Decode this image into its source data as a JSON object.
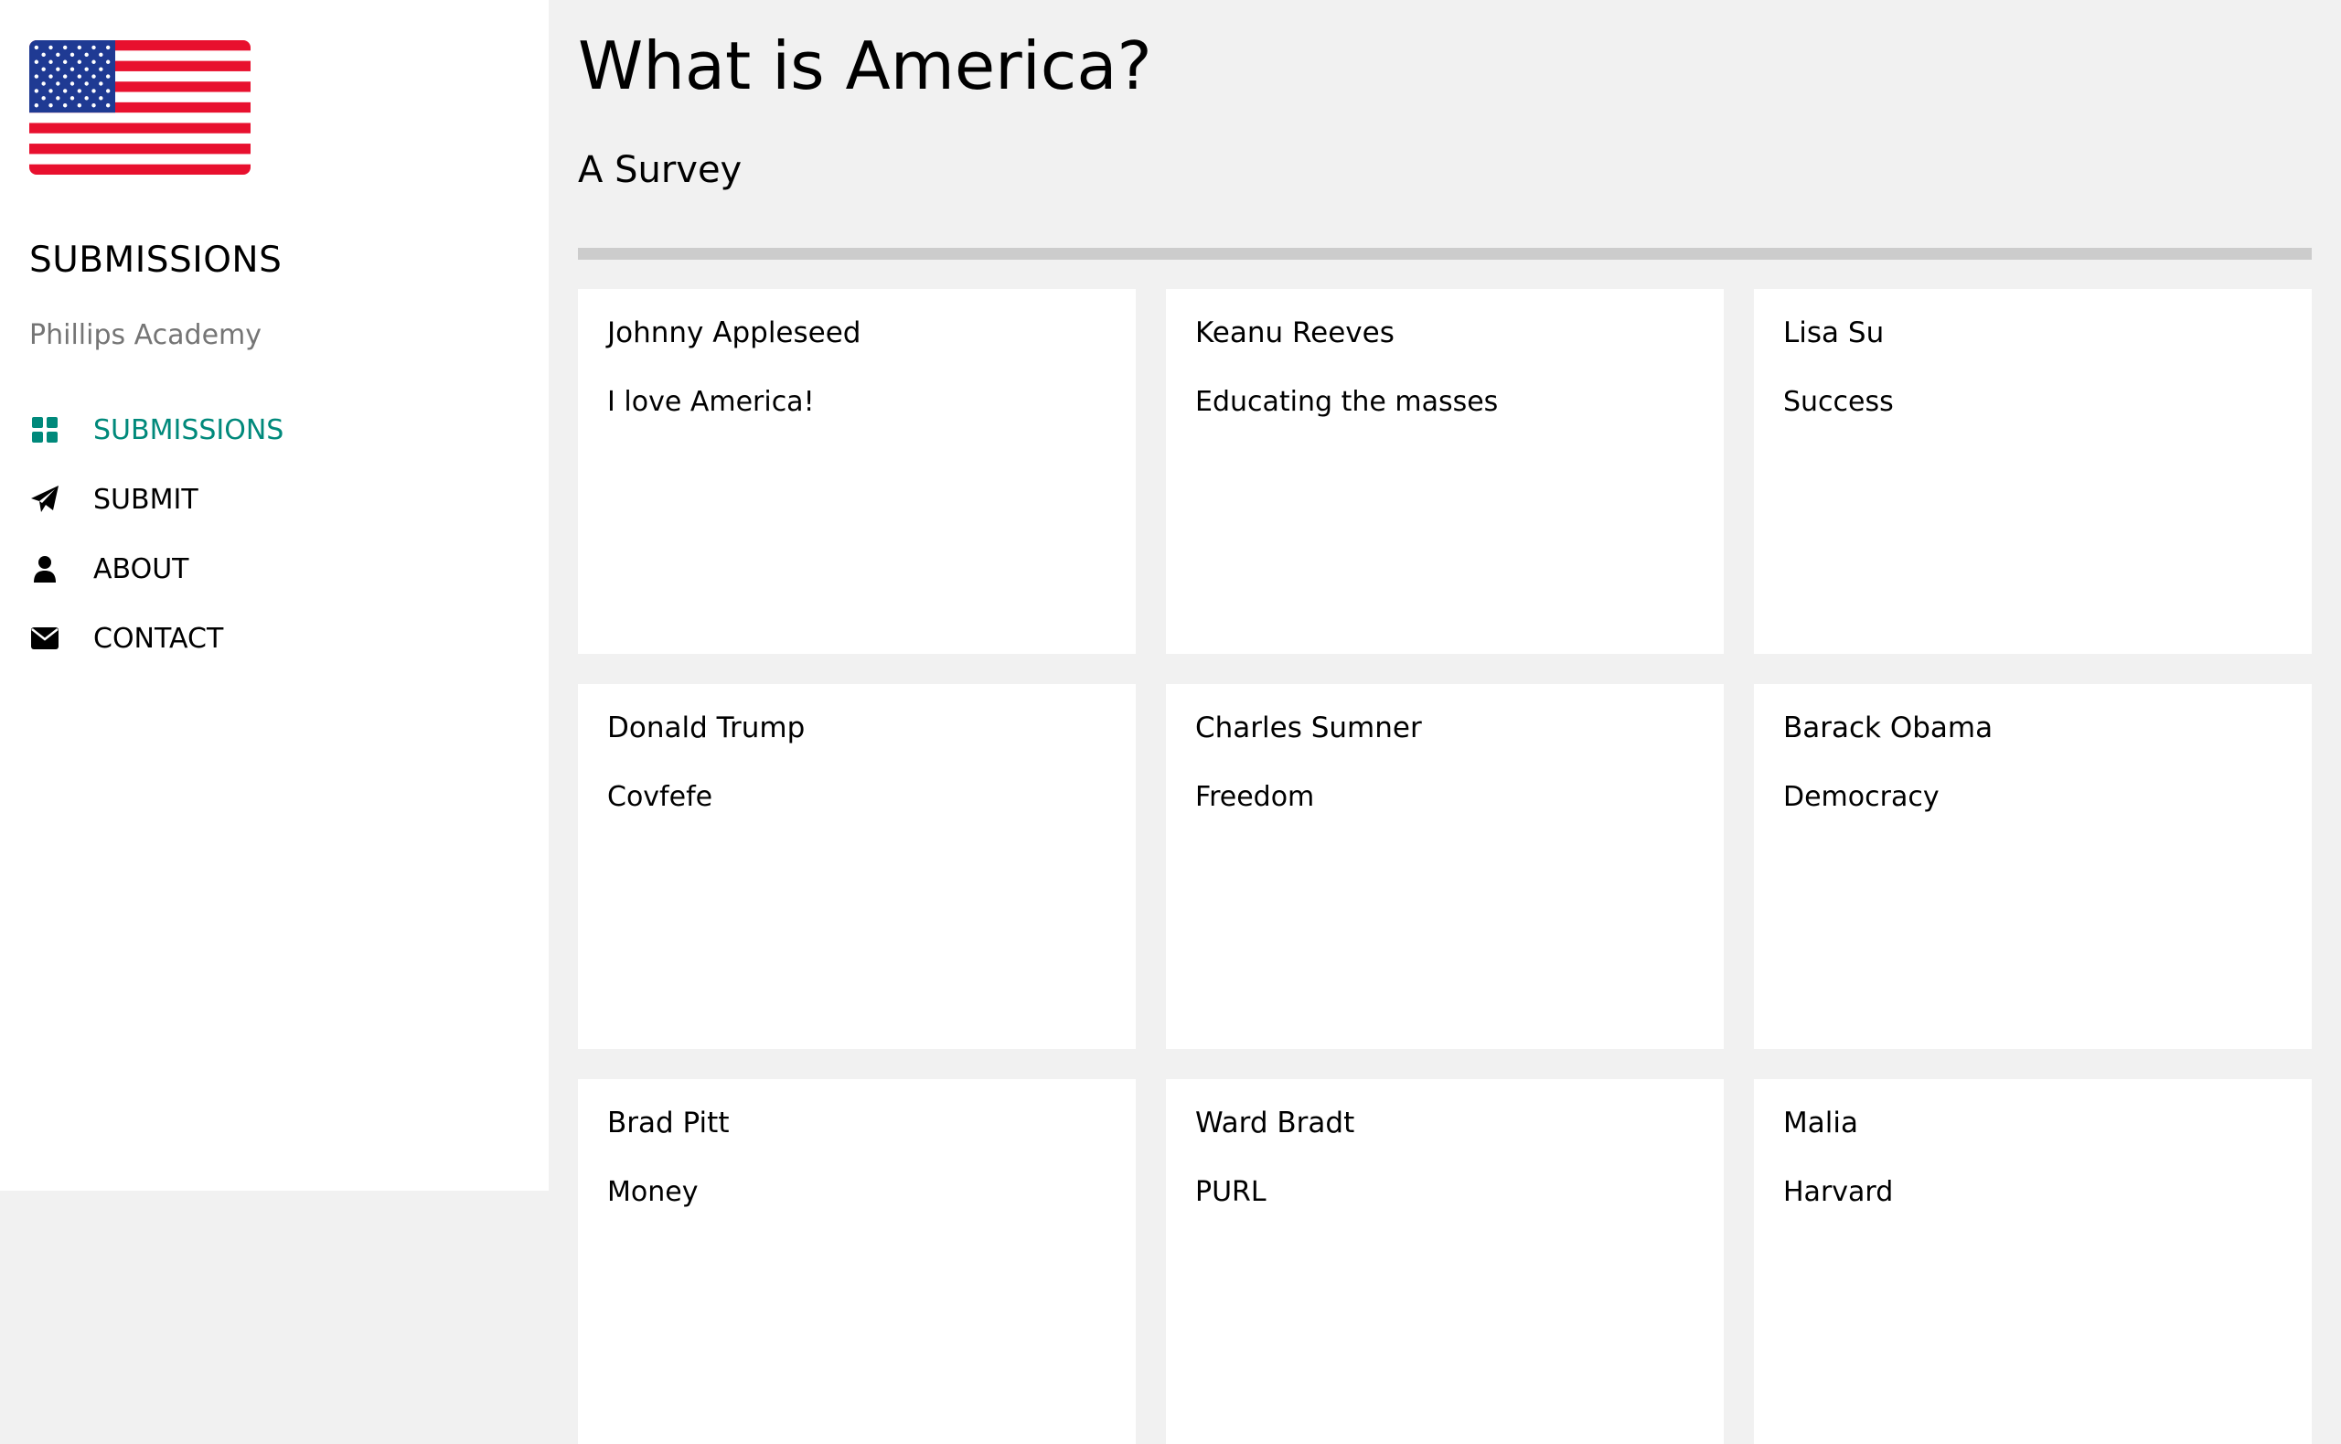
{
  "sidebar": {
    "logo_icon": "us-flag",
    "title": "SUBMISSIONS",
    "subtitle": "Phillips Academy",
    "nav": [
      {
        "label": "SUBMISSIONS",
        "icon": "dashboard-icon",
        "active": true
      },
      {
        "label": "SUBMIT",
        "icon": "paper-plane-icon",
        "active": false
      },
      {
        "label": "ABOUT",
        "icon": "user-icon",
        "active": false
      },
      {
        "label": "CONTACT",
        "icon": "envelope-icon",
        "active": false
      }
    ]
  },
  "main": {
    "title": "What is America?",
    "subtitle": "A Survey",
    "cards": [
      {
        "name": "Johnny Appleseed",
        "text": "I love America!"
      },
      {
        "name": "Keanu Reeves",
        "text": "Educating the masses"
      },
      {
        "name": "Lisa Su",
        "text": "Success"
      },
      {
        "name": "Donald Trump",
        "text": "Covfefe"
      },
      {
        "name": "Charles Sumner",
        "text": "Freedom"
      },
      {
        "name": "Barack Obama",
        "text": "Democracy"
      },
      {
        "name": "Brad Pitt",
        "text": "Money"
      },
      {
        "name": "Ward Bradt",
        "text": "PURL"
      },
      {
        "name": "Malia",
        "text": "Harvard"
      }
    ]
  },
  "colors": {
    "accent": "#00897b",
    "background": "#f1f1f1",
    "sidebar": "#ffffff",
    "divider": "#cccccc",
    "muted_text": "#757575"
  }
}
